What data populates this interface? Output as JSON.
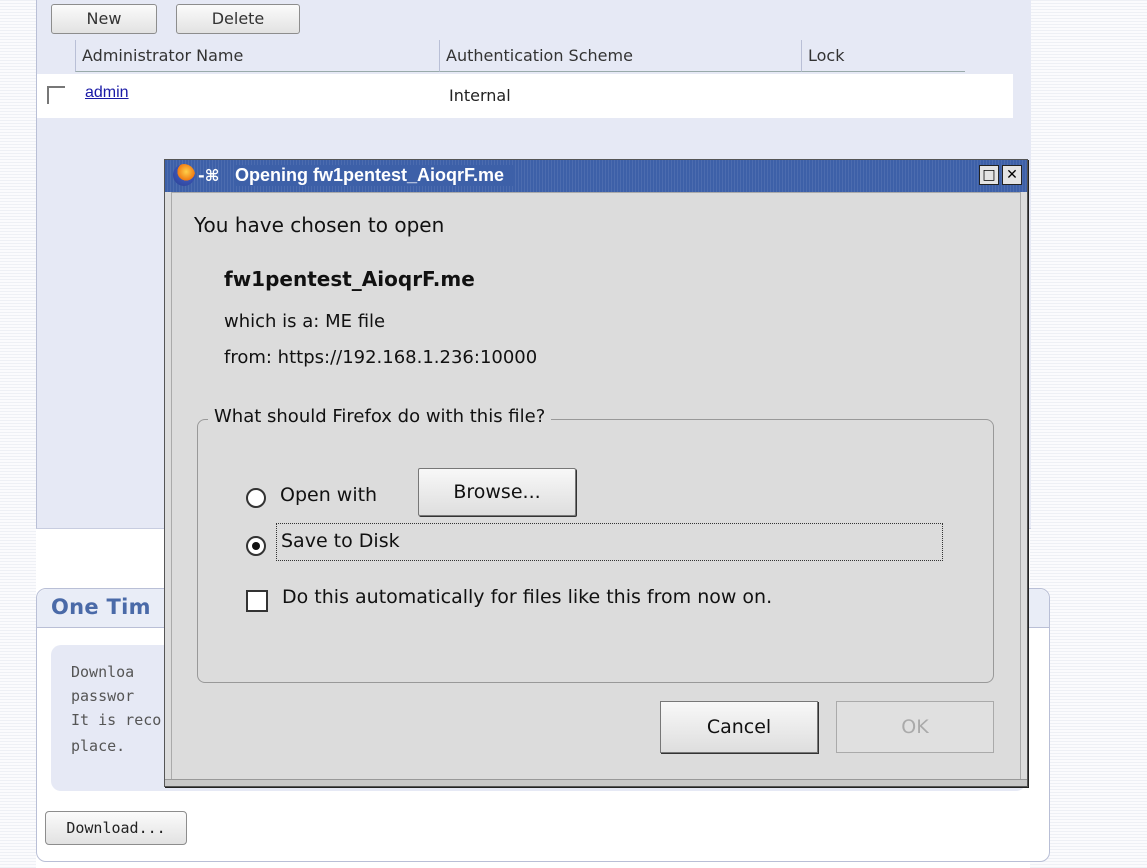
{
  "admin": {
    "buttons": {
      "new": "New",
      "delete": "Delete"
    },
    "columns": [
      "Administrator Name",
      "Authentication Scheme",
      "Lock"
    ],
    "rows": [
      {
        "name": "admin",
        "auth": "Internal",
        "lock": ""
      }
    ]
  },
  "onetime": {
    "title": "One Tim",
    "lines": [
      "Downloa",
      "passwor",
      "It is reco",
      "place."
    ],
    "download_label": "Download..."
  },
  "dialog": {
    "title": "Opening fw1pentest_AioqrF.me",
    "intro": "You have chosen to open",
    "filename": "fw1pentest_AioqrF.me",
    "type_line": "which is a: ME file",
    "from_line": "from: https://192.168.1.236:10000",
    "question": "What should Firefox do with this file?",
    "open_with_label": "Open with",
    "browse_label": "Browse...",
    "save_label": "Save to Disk",
    "selected_option": "save",
    "auto_label": "Do this automatically for files like this from now on.",
    "auto_checked": false,
    "cancel_label": "Cancel",
    "ok_label": "OK",
    "ok_disabled": true,
    "maximize_glyph": "□",
    "close_glyph": "✕",
    "pin_glyph": "-⌘"
  },
  "colors": {
    "titlebar": "#3d60a8",
    "link": "#1a1aa6",
    "panel": "#e6e9f5",
    "dialog_bg": "#dcdcdc"
  },
  "icons": [
    "firefox-icon",
    "pin-icon",
    "maximize-icon",
    "close-icon"
  ]
}
